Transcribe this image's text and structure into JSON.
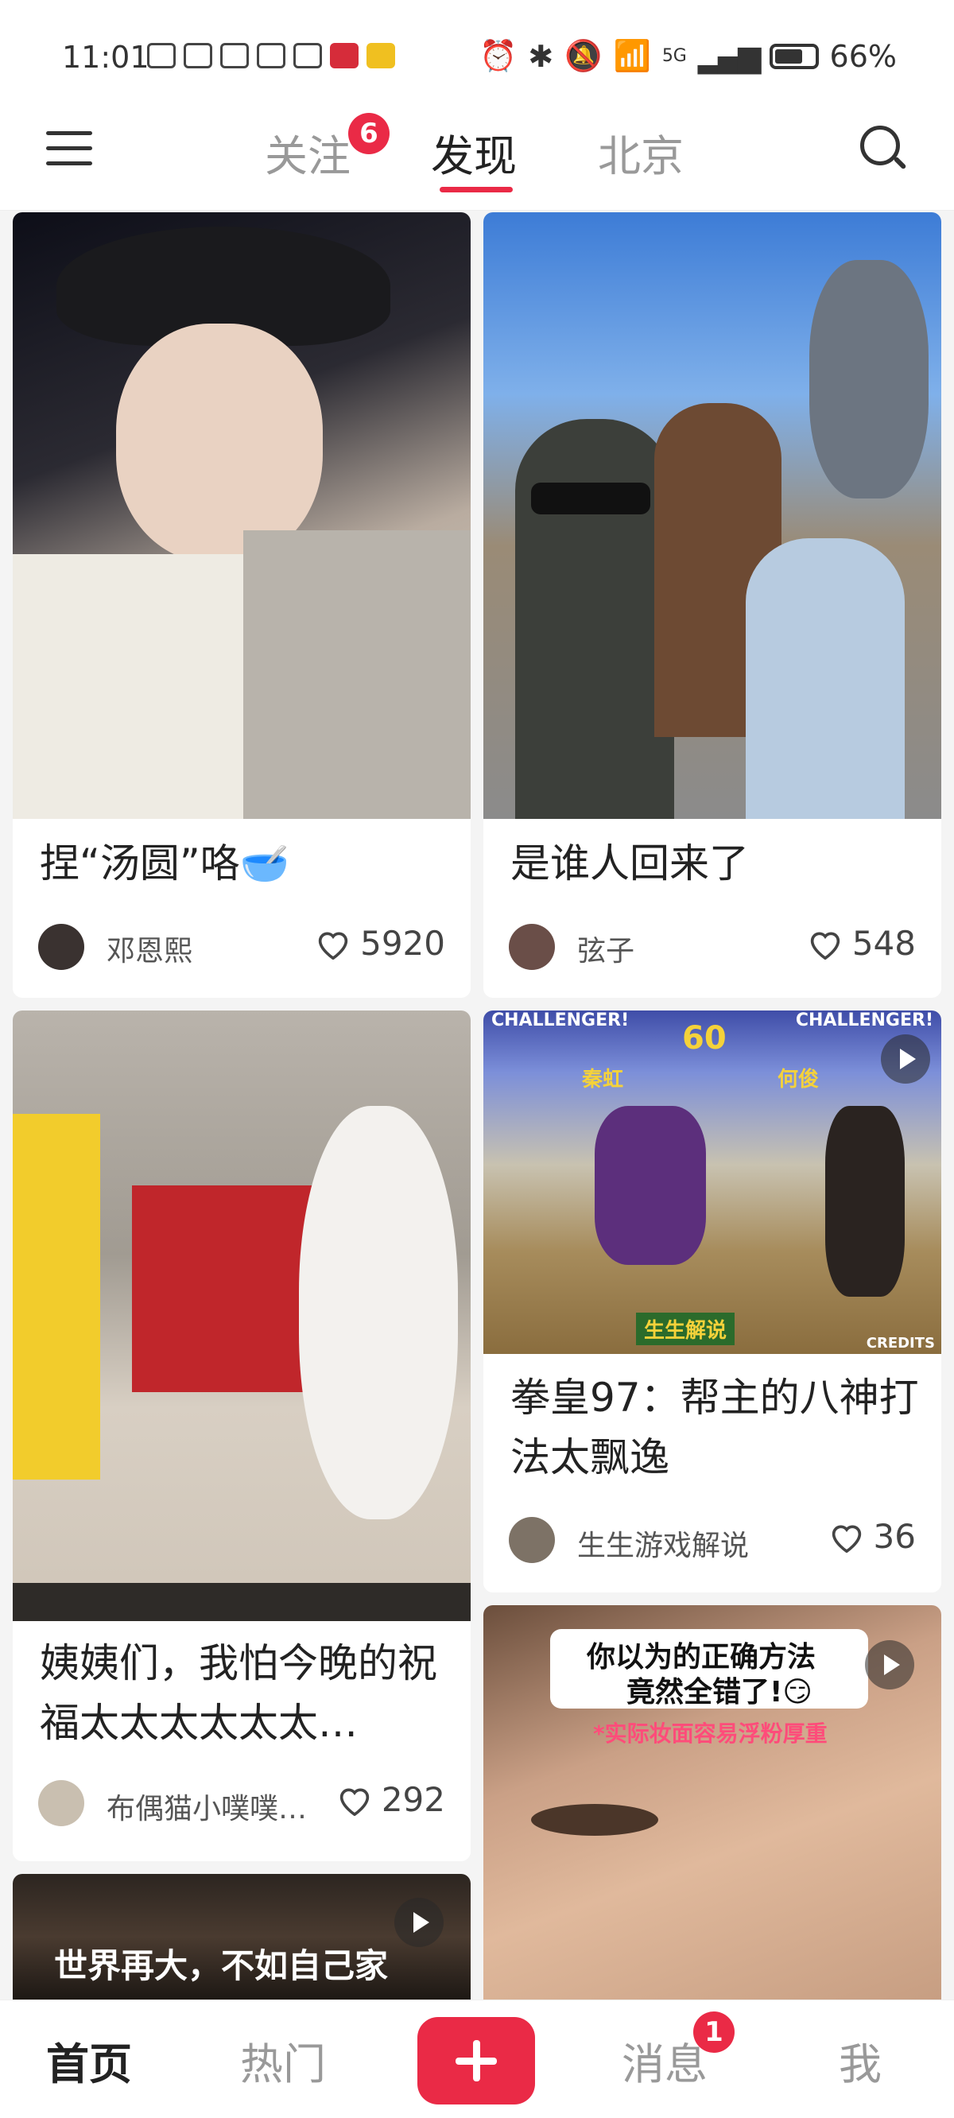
{
  "status_bar": {
    "time": "11:01",
    "network": "5G",
    "battery": "66%"
  },
  "top_nav": {
    "tabs": [
      {
        "label": "关注",
        "badge": "6"
      },
      {
        "label": "发现"
      },
      {
        "label": "北京"
      }
    ],
    "active_tab": "发现"
  },
  "feed": [
    {
      "title": "捏“汤圆”咯🥣",
      "author": "邓恩熙",
      "likes": "5920"
    },
    {
      "title": "是谁人回来了",
      "author": "弦子",
      "likes": "548"
    },
    {
      "title": "姨姨们，我怕今晚的祝福太太太太太太…",
      "author": "布偶猫小噗噗…",
      "likes": "292"
    },
    {
      "title": "拳皇97：帮主的八神打法太飘逸",
      "author": "生生游戏解说",
      "likes": "36",
      "overlay": {
        "challenger_left": "CHALLENGER!",
        "challenger_right": "CHALLENGER!",
        "timer": "60",
        "p1_name": "秦虹",
        "p2_name": "何俊",
        "caption": "生生解说",
        "credits": "CREDITS"
      }
    },
    {
      "overlay": {
        "line1": "你以为的正确方法",
        "line2": "竟然全错了!😏",
        "subline": "*实际妆面容易浮粉厚重"
      }
    },
    {
      "overlay": {
        "line1": "世界再大，不如自己家"
      }
    }
  ],
  "bottom_nav": {
    "items": [
      {
        "label": "首页"
      },
      {
        "label": "热门"
      },
      {
        "label": "消息",
        "badge": "1"
      },
      {
        "label": "我"
      }
    ],
    "active": "首页"
  },
  "colors": {
    "accent": "#ea2a46",
    "background": "#f4f4f4"
  }
}
